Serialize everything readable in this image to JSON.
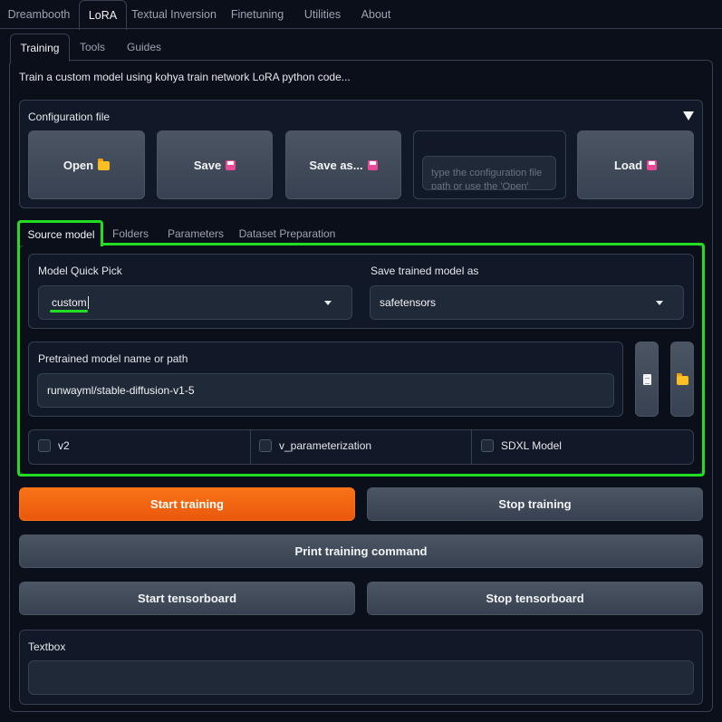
{
  "top_tabs": [
    "Dreambooth",
    "LoRA",
    "Textual Inversion",
    "Finetuning",
    "Utilities",
    "About"
  ],
  "sub_tabs": [
    "Training",
    "Tools",
    "Guides"
  ],
  "description": "Train a custom model using kohya train network LoRA python code...",
  "config": {
    "title": "Configuration file",
    "open_label": "Open",
    "save_label": "Save",
    "save_as_label": "Save as...",
    "load_label": "Load",
    "path_placeholder": "type the configuration file path or use the 'Open' button above to select it..."
  },
  "section_tabs": [
    "Source model",
    "Folders",
    "Parameters",
    "Dataset Preparation"
  ],
  "source_model": {
    "quick_pick_label": "Model Quick Pick",
    "quick_pick_value": "custom",
    "save_as_label": "Save trained model as",
    "save_as_value": "safetensors",
    "pretrained_label": "Pretrained model name or path",
    "pretrained_value": "runwayml/stable-diffusion-v1-5",
    "checkboxes": [
      "v2",
      "v_parameterization",
      "SDXL Model"
    ]
  },
  "actions": {
    "start_training": "Start training",
    "stop_training": "Stop training",
    "print_command": "Print training command",
    "start_tensorboard": "Start tensorboard",
    "stop_tensorboard": "Stop tensorboard"
  },
  "textbox": {
    "label": "Textbox",
    "value": ""
  },
  "colors": {
    "primary": "#f97316",
    "highlight": "#22dd22",
    "background": "#0b0f19"
  }
}
